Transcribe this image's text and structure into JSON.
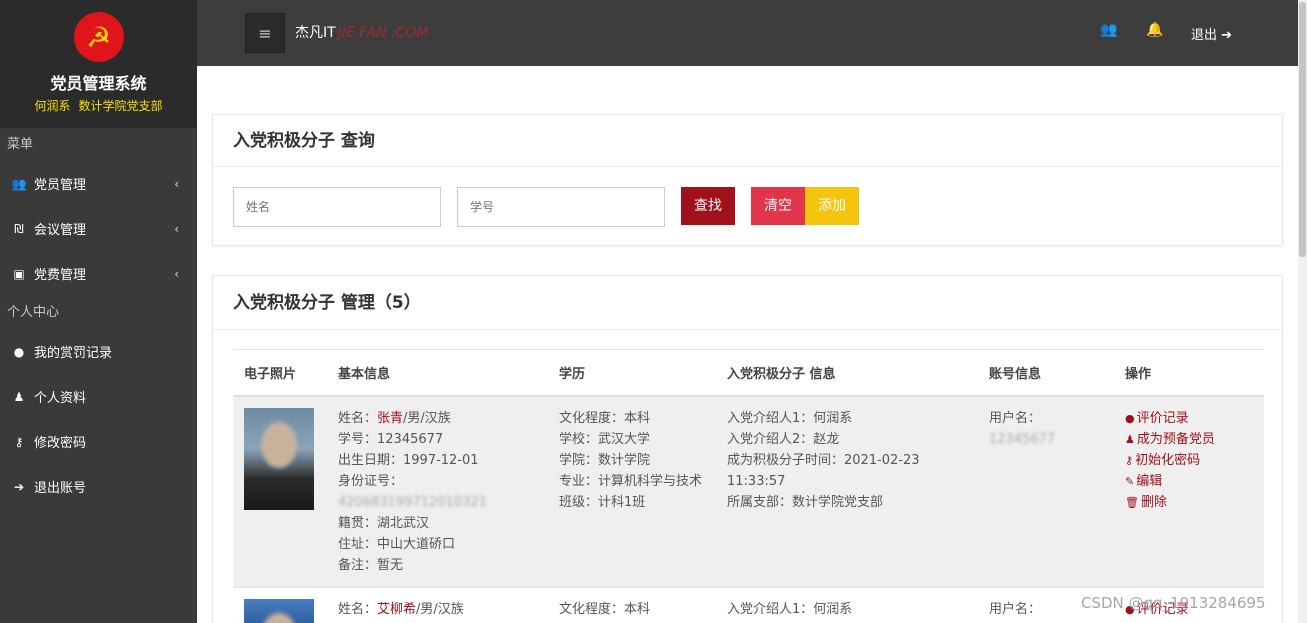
{
  "sidebar": {
    "emblem_icon": "party-emblem-icon",
    "title": "党员管理系统",
    "subtitle_name": "何润系",
    "subtitle_org": "数计学院党支部",
    "section_menu": "菜单",
    "menu": [
      {
        "label": "党员管理",
        "icon": "users-icon"
      },
      {
        "label": "会议管理",
        "icon": "meeting-icon"
      },
      {
        "label": "党费管理",
        "icon": "money-icon"
      }
    ],
    "section_personal": "个人中心",
    "personal": [
      {
        "label": "我的赏罚记录",
        "icon": "comment-icon"
      },
      {
        "label": "个人资料",
        "icon": "user-icon"
      },
      {
        "label": "修改密码",
        "icon": "key-icon"
      },
      {
        "label": "退出账号",
        "icon": "sign-out-icon"
      }
    ]
  },
  "topbar": {
    "brand": "杰凡IT",
    "watermark": "JIE FAN .COM",
    "logout": "退出"
  },
  "search": {
    "title": "入党积极分子 查询",
    "name_placeholder": "姓名",
    "id_placeholder": "学号",
    "find": "查找",
    "clear": "清空",
    "add": "添加"
  },
  "table": {
    "title": "入党积极分子 管理（5）",
    "headers": [
      "电子照片",
      "基本信息",
      "学历",
      "入党积极分子 信息",
      "账号信息",
      "操作"
    ],
    "rows": [
      {
        "name_label": "姓名：",
        "name": "张青",
        "name_rest": "/男/汉族",
        "sid": "学号：12345677",
        "birth": "出生日期：1997-12-01",
        "idcard_label": "身份证号：",
        "idcard": "420683199712010321",
        "origin": "籍贯：湖北武汉",
        "address": "住址：中山大道硚口",
        "note": "备注：暂无",
        "edu_level": "文化程度：本科",
        "school": "学校：武汉大学",
        "college": "学院：数计学院",
        "major": "专业：计算机科学与技术",
        "class": "班级：计科1班",
        "intro1": "入党介绍人1：何润系",
        "intro2": "入党介绍人2：赵龙",
        "active_time": "成为积极分子时间：2021-02-23 11:33:57",
        "branch": "所属支部：数计学院党支部",
        "username_label": "用户名：",
        "username": "12345677",
        "ops": [
          "评价记录",
          "成为预备党员",
          "初始化密码",
          "编辑",
          "删除"
        ]
      },
      {
        "name_label": "姓名：",
        "name": "艾柳希",
        "name_rest": "/男/汉族",
        "edu_level": "文化程度：本科",
        "intro1": "入党介绍人1：何润系",
        "username_label": "用户名：",
        "ops": [
          "评价记录"
        ]
      }
    ]
  },
  "watermark_bottom": "CSDN @qq_1913284695"
}
